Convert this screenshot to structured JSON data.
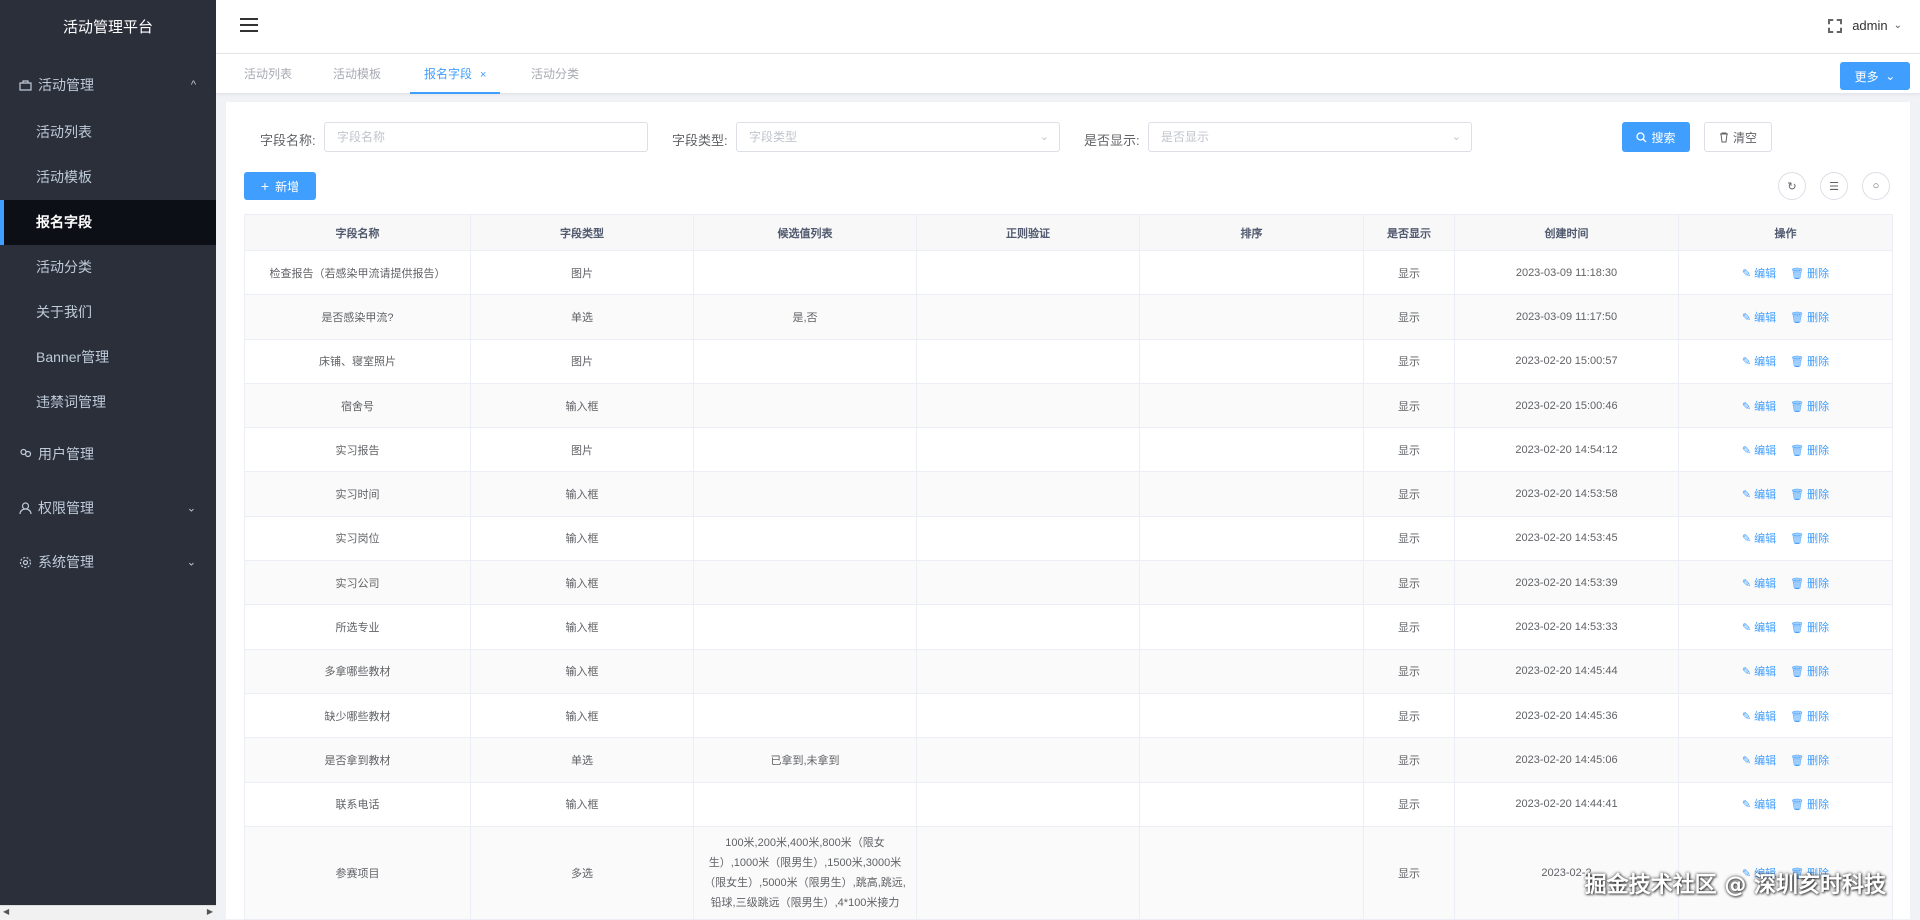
{
  "sidebar": {
    "title": "活动管理平台",
    "groups": [
      {
        "label": "活动管理",
        "icon": "briefcase-icon",
        "chevron": "^"
      },
      {
        "label": "用户管理",
        "icon": "users-icon"
      },
      {
        "label": "权限管理",
        "icon": "user-icon",
        "chevron": "⌄"
      },
      {
        "label": "系统管理",
        "icon": "gear-icon",
        "chevron": "⌄"
      }
    ],
    "items": [
      "活动列表",
      "活动模板",
      "报名字段",
      "活动分类",
      "关于我们",
      "Banner管理",
      "违禁词管理"
    ],
    "active_item": "报名字段"
  },
  "navbar": {
    "user": "admin"
  },
  "tags": [
    {
      "label": "活动列表"
    },
    {
      "label": "活动模板"
    },
    {
      "label": "报名字段",
      "close": "×",
      "active": true
    },
    {
      "label": "活动分类"
    }
  ],
  "more_button": "更多",
  "filters": {
    "name_label": "字段名称:",
    "name_placeholder": "字段名称",
    "type_label": "字段类型:",
    "type_placeholder": "字段类型",
    "show_label": "是否显示:",
    "show_placeholder": "是否显示",
    "search_button": "搜索",
    "clear_button": "清空"
  },
  "add_button": "新增",
  "table": {
    "columns": [
      "字段名称",
      "字段类型",
      "候选值列表",
      "正则验证",
      "排序",
      "是否显示",
      "创建时间",
      "操作"
    ],
    "edit_label": "编辑",
    "delete_label": "删除",
    "rows": [
      {
        "name": "检查报告（若感染甲流请提供报告）",
        "type": "图片",
        "options": "",
        "regex": "",
        "sort": "",
        "show": "显示",
        "created": "2023-03-09 11:18:30"
      },
      {
        "name": "是否感染甲流?",
        "type": "单选",
        "options": "是,否",
        "regex": "",
        "sort": "",
        "show": "显示",
        "created": "2023-03-09 11:17:50"
      },
      {
        "name": "床铺、寝室照片",
        "type": "图片",
        "options": "",
        "regex": "",
        "sort": "",
        "show": "显示",
        "created": "2023-02-20 15:00:57"
      },
      {
        "name": "宿舍号",
        "type": "输入框",
        "options": "",
        "regex": "",
        "sort": "",
        "show": "显示",
        "created": "2023-02-20 15:00:46"
      },
      {
        "name": "实习报告",
        "type": "图片",
        "options": "",
        "regex": "",
        "sort": "",
        "show": "显示",
        "created": "2023-02-20 14:54:12"
      },
      {
        "name": "实习时间",
        "type": "输入框",
        "options": "",
        "regex": "",
        "sort": "",
        "show": "显示",
        "created": "2023-02-20 14:53:58"
      },
      {
        "name": "实习岗位",
        "type": "输入框",
        "options": "",
        "regex": "",
        "sort": "",
        "show": "显示",
        "created": "2023-02-20 14:53:45"
      },
      {
        "name": "实习公司",
        "type": "输入框",
        "options": "",
        "regex": "",
        "sort": "",
        "show": "显示",
        "created": "2023-02-20 14:53:39"
      },
      {
        "name": "所选专业",
        "type": "输入框",
        "options": "",
        "regex": "",
        "sort": "",
        "show": "显示",
        "created": "2023-02-20 14:53:33"
      },
      {
        "name": "多拿哪些教材",
        "type": "输入框",
        "options": "",
        "regex": "",
        "sort": "",
        "show": "显示",
        "created": "2023-02-20 14:45:44"
      },
      {
        "name": "缺少哪些教材",
        "type": "输入框",
        "options": "",
        "regex": "",
        "sort": "",
        "show": "显示",
        "created": "2023-02-20 14:45:36"
      },
      {
        "name": "是否拿到教材",
        "type": "单选",
        "options": "已拿到,未拿到",
        "regex": "",
        "sort": "",
        "show": "显示",
        "created": "2023-02-20 14:45:06"
      },
      {
        "name": "联系电话",
        "type": "输入框",
        "options": "",
        "regex": "",
        "sort": "",
        "show": "显示",
        "created": "2023-02-20 14:44:41"
      },
      {
        "name": "参赛项目",
        "type": "多选",
        "options": "100米,200米,400米,800米（限女生）,1000米（限男生）,1500米,3000米（限女生）,5000米（限男生）,跳高,跳远,铅球,三级跳远（限男生）,4*100米接力",
        "regex": "",
        "sort": "",
        "show": "显示",
        "created": "2023-02-2"
      }
    ]
  },
  "watermark": "掘金技术社区 @ 深圳亥时科技",
  "colors": {
    "primary": "#409eff",
    "sidebar_bg": "#2b2f3a"
  }
}
